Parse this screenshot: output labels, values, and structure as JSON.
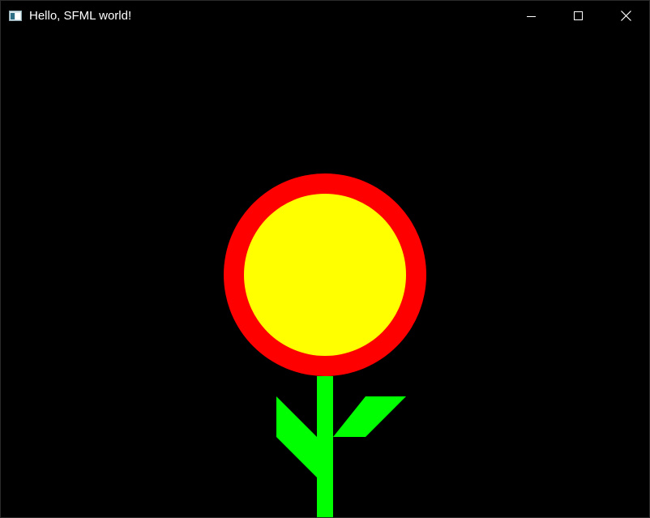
{
  "window": {
    "title": "Hello, SFML world!",
    "icons": {
      "app": "window-app-icon",
      "minimize": "minimize-icon",
      "maximize": "maximize-icon",
      "close": "close-icon"
    }
  },
  "scene": {
    "background_color": "#000000",
    "shapes": [
      {
        "name": "flower-petal-ring",
        "kind": "circle",
        "color": "#ff0000"
      },
      {
        "name": "flower-center",
        "kind": "circle",
        "color": "#ffff00"
      },
      {
        "name": "flower-stem",
        "kind": "rectangle",
        "color": "#00ff00"
      },
      {
        "name": "left-leaf",
        "kind": "polygon",
        "color": "#00ff00"
      },
      {
        "name": "right-leaf",
        "kind": "polygon",
        "color": "#00ff00"
      }
    ]
  }
}
